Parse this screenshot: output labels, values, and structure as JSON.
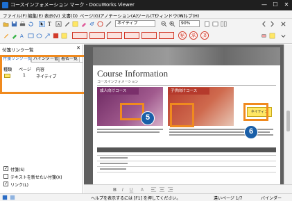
{
  "window": {
    "title": "コースインフォメーション マーク - DocuWorks Viewer",
    "controls": [
      "—",
      "☐",
      "✕"
    ]
  },
  "menu": [
    "ファイル(F)",
    "編集(E)",
    "表示(V)",
    "文書(D)",
    "ページ(G)",
    "アノテーション(A)",
    "ツール(T)",
    "ウィンドウ(W)",
    "ヘルプ(H)"
  ],
  "toolbar": {
    "annotation_dropdown": "ネイティブ",
    "zoom_value": "90%",
    "stamps": [
      "秘",
      "承",
      "済"
    ]
  },
  "panel": {
    "title": "付箋リンク一覧",
    "close_label": "✕",
    "tabs": [
      "付箋リンク一覧",
      "バインダー管理",
      "署名一覧"
    ],
    "columns": [
      "種類",
      "ページ",
      "内容"
    ],
    "rows": [
      {
        "type_icon": "note-icon",
        "page": "1",
        "content": "ネイティブ"
      }
    ],
    "options": [
      {
        "label": "付箋(S)",
        "checked": true
      },
      {
        "label": "テキストを新せたい付箋(X)",
        "checked": false
      },
      {
        "label": "リンク(L)",
        "checked": true
      }
    ]
  },
  "document": {
    "heading": "Course Information",
    "subheading": "コースインフォメーション",
    "banner_left": "成人向けコース",
    "banner_right": "子供向けコース",
    "annotation_text": "ネイティブ"
  },
  "callout_badges": [
    "5",
    "6"
  ],
  "statusbar": {
    "help": "ヘルプを表示するには [F1] を押してください。",
    "pages": "違いページ 1/7",
    "binder": "バインダー"
  },
  "colors": {
    "callout": "#f08a1e",
    "badge": "#1a5fa8",
    "purple_banner": "#7a2f6b",
    "red_banner": "#b53a2c"
  }
}
